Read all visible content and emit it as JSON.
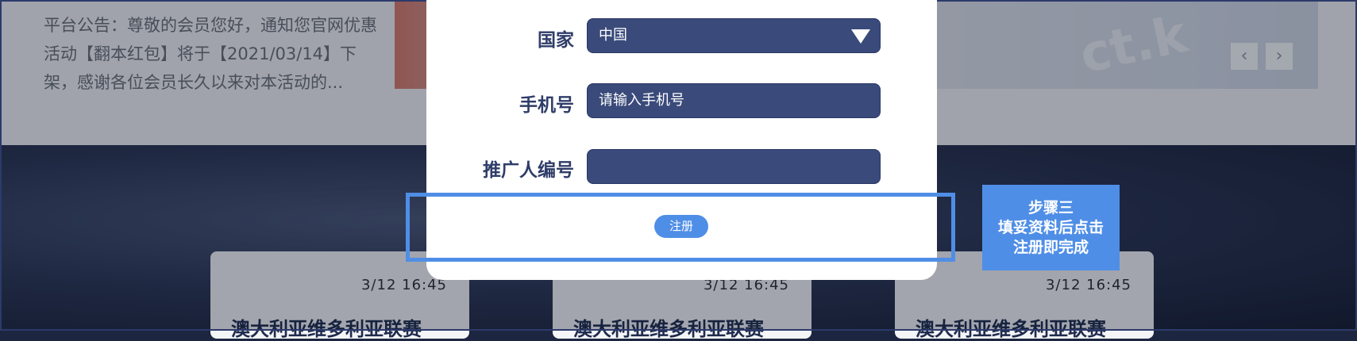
{
  "announcement": {
    "text": "平台公告：尊敬的会员您好，通知您官网优惠活动【翻本红包】将于【2021/03/14】下架，感谢各位会员长久以来对本活动的..."
  },
  "banner": {
    "watermark": "ct.k",
    "prev_icon": "chevron-left-icon",
    "next_icon": "chevron-right-icon"
  },
  "news": [
    {
      "time": "3/12 16:45",
      "title": "澳大利亚维多利亚联赛"
    },
    {
      "time": "3/12 16:45",
      "title": "澳大利亚维多利亚联赛"
    },
    {
      "time": "3/12 16:45",
      "title": "澳大利亚维多利亚联赛"
    }
  ],
  "form": {
    "country_label": "国家",
    "country_value": "中国",
    "phone_label": "手机号",
    "phone_placeholder": "请输入手机号",
    "promo_label": "推广人编号",
    "promo_value": "",
    "register_label": "注册"
  },
  "step": {
    "line1": "步骤三",
    "line2": "填妥资料后点击",
    "line3": "注册即完成"
  },
  "colors": {
    "accent": "#4f8ee6",
    "field_bg": "#3a4a7a",
    "label": "#2f3d69"
  }
}
